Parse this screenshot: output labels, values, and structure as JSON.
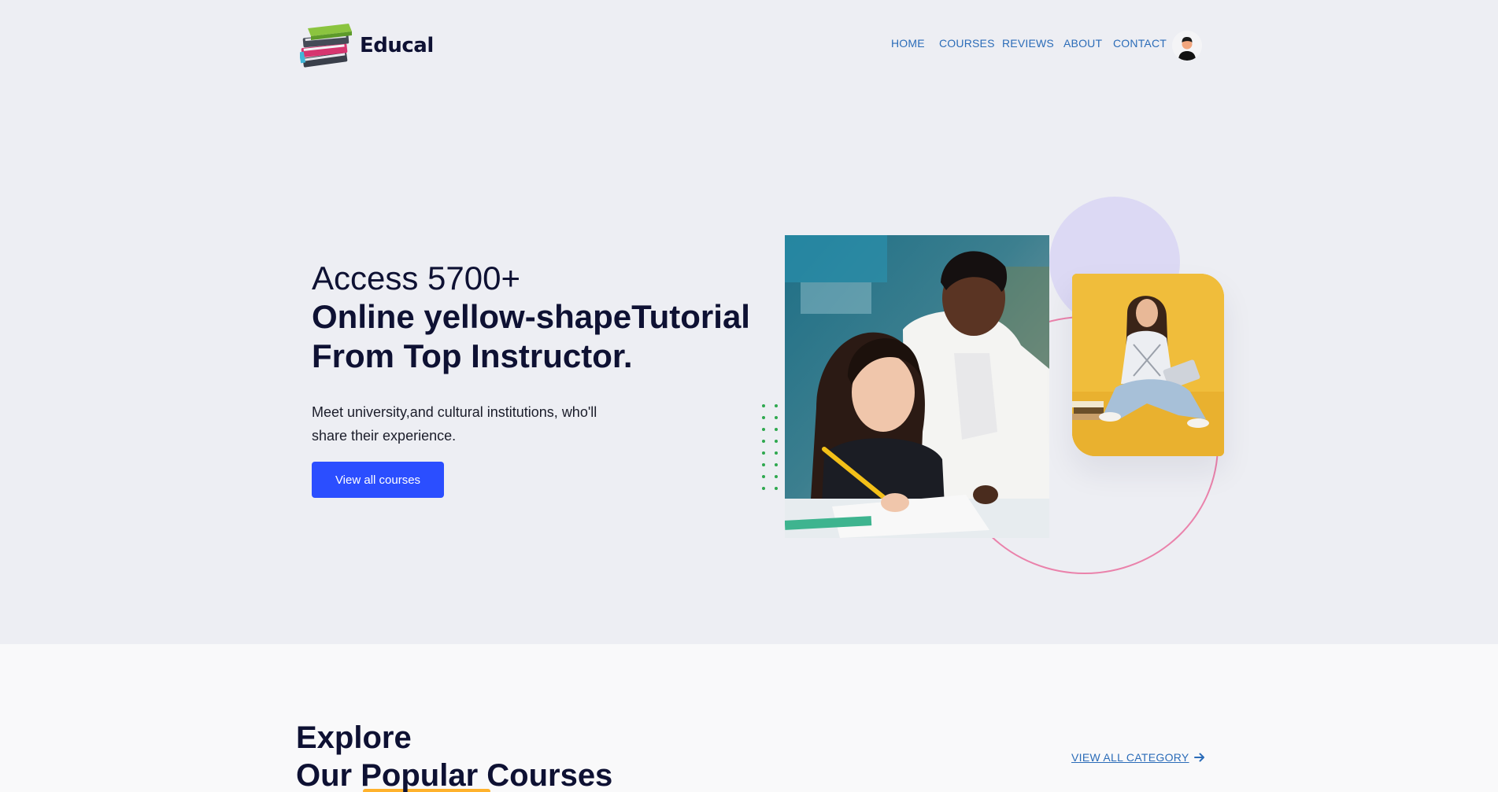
{
  "brand": {
    "name": "Educal"
  },
  "nav": {
    "items": [
      {
        "label": "HOME"
      },
      {
        "label": "COURSES"
      },
      {
        "label": "REVIEWS"
      },
      {
        "label": "ABOUT"
      },
      {
        "label": "CONTACT"
      }
    ],
    "avatar_icon": "user-avatar-icon"
  },
  "hero": {
    "title_light": "Access 5700+",
    "title_bold_1": "Online yellow-shapeTutorial",
    "title_bold_2": "From Top Instructor.",
    "description": "Meet university,and cultural institutions, who'll share their experience.",
    "cta_label": "View all courses",
    "colors": {
      "accent": "#2b4eff",
      "ring": "#ea82ab",
      "lilac": "#dcd9f4",
      "dots": "#2fa84f",
      "card": "#f0bd3b"
    }
  },
  "explore": {
    "title_line_1": "Explore",
    "title_line_2": "Our Popular Courses",
    "view_all_label": "VIEW ALL CATEGORY",
    "view_all_icon": "arrow-right-icon",
    "highlight_color": "#ffb22c"
  }
}
